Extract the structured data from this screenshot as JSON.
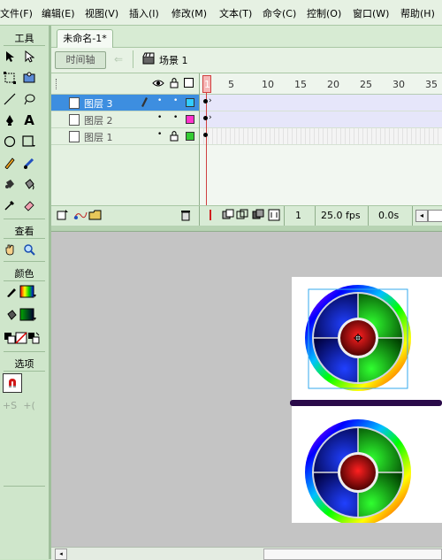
{
  "menubar": {
    "items": [
      "文件(F)",
      "编辑(E)",
      "视图(V)",
      "插入(I)",
      "修改(M)",
      "文本(T)",
      "命令(C)",
      "控制(O)",
      "窗口(W)",
      "帮助(H)"
    ]
  },
  "toolbox": {
    "tools_header": "工具",
    "view_header": "查看",
    "colors_header": "颜色",
    "options_header": "选项"
  },
  "document": {
    "tab_title": "未命名-1*",
    "timeline_button": "时间轴",
    "scene_label": "场景 1"
  },
  "timeline": {
    "frame_numbers": [
      "1",
      "5",
      "10",
      "15",
      "20",
      "25",
      "30",
      "35"
    ],
    "layers": [
      {
        "name": "图层 3",
        "selected": true,
        "locked": false,
        "color": "#33ccff"
      },
      {
        "name": "图层 2",
        "selected": false,
        "locked": false,
        "color": "#ff33cc"
      },
      {
        "name": "图层 1",
        "selected": false,
        "locked": true,
        "color": "#33cc33"
      }
    ],
    "current_frame": "1",
    "fps": "25.0 fps",
    "elapsed": "0.0s"
  },
  "colors": {
    "accent": "#33ccff",
    "divider_bar": "#2a0a4a"
  }
}
